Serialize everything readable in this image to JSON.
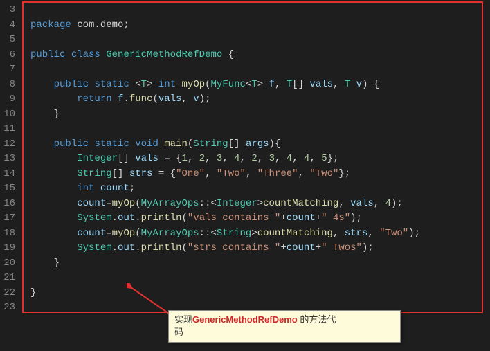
{
  "gutter": {
    "start": 3,
    "end": 23
  },
  "code_lines": [
    {
      "parts": [
        {
          "c": "pun",
          "t": ""
        }
      ]
    },
    {
      "parts": [
        {
          "c": "kw",
          "t": "package"
        },
        {
          "c": "pun",
          "t": " com.demo;"
        }
      ]
    },
    {
      "parts": [
        {
          "c": "pun",
          "t": ""
        }
      ]
    },
    {
      "parts": [
        {
          "c": "kw",
          "t": "public"
        },
        {
          "c": "pun",
          "t": " "
        },
        {
          "c": "kw",
          "t": "class"
        },
        {
          "c": "pun",
          "t": " "
        },
        {
          "c": "typ",
          "t": "GenericMethodRefDemo"
        },
        {
          "c": "pun",
          "t": " {"
        }
      ]
    },
    {
      "parts": [
        {
          "c": "pun",
          "t": ""
        }
      ]
    },
    {
      "parts": [
        {
          "c": "pun",
          "t": "    "
        },
        {
          "c": "kw",
          "t": "public"
        },
        {
          "c": "pun",
          "t": " "
        },
        {
          "c": "kw",
          "t": "static"
        },
        {
          "c": "pun",
          "t": " <"
        },
        {
          "c": "typ",
          "t": "T"
        },
        {
          "c": "pun",
          "t": "> "
        },
        {
          "c": "kw",
          "t": "int"
        },
        {
          "c": "pun",
          "t": " "
        },
        {
          "c": "mth",
          "t": "myOp"
        },
        {
          "c": "pun",
          "t": "("
        },
        {
          "c": "typ",
          "t": "MyFunc"
        },
        {
          "c": "pun",
          "t": "<"
        },
        {
          "c": "typ",
          "t": "T"
        },
        {
          "c": "pun",
          "t": "> "
        },
        {
          "c": "var",
          "t": "f"
        },
        {
          "c": "pun",
          "t": ", "
        },
        {
          "c": "typ",
          "t": "T"
        },
        {
          "c": "pun",
          "t": "[] "
        },
        {
          "c": "var",
          "t": "vals"
        },
        {
          "c": "pun",
          "t": ", "
        },
        {
          "c": "typ",
          "t": "T"
        },
        {
          "c": "pun",
          "t": " "
        },
        {
          "c": "var",
          "t": "v"
        },
        {
          "c": "pun",
          "t": ") {"
        }
      ]
    },
    {
      "parts": [
        {
          "c": "pun",
          "t": "        "
        },
        {
          "c": "kw",
          "t": "return"
        },
        {
          "c": "pun",
          "t": " "
        },
        {
          "c": "var",
          "t": "f"
        },
        {
          "c": "pun",
          "t": "."
        },
        {
          "c": "mth",
          "t": "func"
        },
        {
          "c": "pun",
          "t": "("
        },
        {
          "c": "var",
          "t": "vals"
        },
        {
          "c": "pun",
          "t": ", "
        },
        {
          "c": "var",
          "t": "v"
        },
        {
          "c": "pun",
          "t": ");"
        }
      ]
    },
    {
      "parts": [
        {
          "c": "pun",
          "t": "    }"
        }
      ]
    },
    {
      "parts": [
        {
          "c": "pun",
          "t": ""
        }
      ]
    },
    {
      "parts": [
        {
          "c": "pun",
          "t": "    "
        },
        {
          "c": "kw",
          "t": "public"
        },
        {
          "c": "pun",
          "t": " "
        },
        {
          "c": "kw",
          "t": "static"
        },
        {
          "c": "pun",
          "t": " "
        },
        {
          "c": "kw",
          "t": "void"
        },
        {
          "c": "pun",
          "t": " "
        },
        {
          "c": "mth",
          "t": "main"
        },
        {
          "c": "pun",
          "t": "("
        },
        {
          "c": "typ",
          "t": "String"
        },
        {
          "c": "pun",
          "t": "[] "
        },
        {
          "c": "var",
          "t": "args"
        },
        {
          "c": "pun",
          "t": "){"
        }
      ]
    },
    {
      "parts": [
        {
          "c": "pun",
          "t": "        "
        },
        {
          "c": "typ",
          "t": "Integer"
        },
        {
          "c": "pun",
          "t": "[] "
        },
        {
          "c": "var",
          "t": "vals"
        },
        {
          "c": "pun",
          "t": " = {"
        },
        {
          "c": "num",
          "t": "1"
        },
        {
          "c": "pun",
          "t": ", "
        },
        {
          "c": "num",
          "t": "2"
        },
        {
          "c": "pun",
          "t": ", "
        },
        {
          "c": "num",
          "t": "3"
        },
        {
          "c": "pun",
          "t": ", "
        },
        {
          "c": "num",
          "t": "4"
        },
        {
          "c": "pun",
          "t": ", "
        },
        {
          "c": "num",
          "t": "2"
        },
        {
          "c": "pun",
          "t": ", "
        },
        {
          "c": "num",
          "t": "3"
        },
        {
          "c": "pun",
          "t": ", "
        },
        {
          "c": "num",
          "t": "4"
        },
        {
          "c": "pun",
          "t": ", "
        },
        {
          "c": "num",
          "t": "4"
        },
        {
          "c": "pun",
          "t": ", "
        },
        {
          "c": "num",
          "t": "5"
        },
        {
          "c": "pun",
          "t": "};"
        }
      ]
    },
    {
      "parts": [
        {
          "c": "pun",
          "t": "        "
        },
        {
          "c": "typ",
          "t": "String"
        },
        {
          "c": "pun",
          "t": "[] "
        },
        {
          "c": "var",
          "t": "strs"
        },
        {
          "c": "pun",
          "t": " = {"
        },
        {
          "c": "str",
          "t": "\"One\""
        },
        {
          "c": "pun",
          "t": ", "
        },
        {
          "c": "str",
          "t": "\"Two\""
        },
        {
          "c": "pun",
          "t": ", "
        },
        {
          "c": "str",
          "t": "\"Three\""
        },
        {
          "c": "pun",
          "t": ", "
        },
        {
          "c": "str",
          "t": "\"Two\""
        },
        {
          "c": "pun",
          "t": "};"
        }
      ]
    },
    {
      "parts": [
        {
          "c": "pun",
          "t": "        "
        },
        {
          "c": "kw",
          "t": "int"
        },
        {
          "c": "pun",
          "t": " "
        },
        {
          "c": "var",
          "t": "count"
        },
        {
          "c": "pun",
          "t": ";"
        }
      ]
    },
    {
      "parts": [
        {
          "c": "pun",
          "t": "        "
        },
        {
          "c": "var",
          "t": "count"
        },
        {
          "c": "pun",
          "t": "="
        },
        {
          "c": "mth",
          "t": "myOp"
        },
        {
          "c": "pun",
          "t": "("
        },
        {
          "c": "typ",
          "t": "MyArrayOps"
        },
        {
          "c": "pun",
          "t": "::<"
        },
        {
          "c": "typ",
          "t": "Integer"
        },
        {
          "c": "pun",
          "t": ">"
        },
        {
          "c": "mth",
          "t": "countMatching"
        },
        {
          "c": "pun",
          "t": ", "
        },
        {
          "c": "var",
          "t": "vals"
        },
        {
          "c": "pun",
          "t": ", "
        },
        {
          "c": "num",
          "t": "4"
        },
        {
          "c": "pun",
          "t": ");"
        }
      ]
    },
    {
      "parts": [
        {
          "c": "pun",
          "t": "        "
        },
        {
          "c": "typ",
          "t": "System"
        },
        {
          "c": "pun",
          "t": "."
        },
        {
          "c": "var",
          "t": "out"
        },
        {
          "c": "pun",
          "t": "."
        },
        {
          "c": "mth",
          "t": "println"
        },
        {
          "c": "pun",
          "t": "("
        },
        {
          "c": "str",
          "t": "\"vals contains \""
        },
        {
          "c": "pun",
          "t": "+"
        },
        {
          "c": "var",
          "t": "count"
        },
        {
          "c": "pun",
          "t": "+"
        },
        {
          "c": "str",
          "t": "\" 4s\""
        },
        {
          "c": "pun",
          "t": ");"
        }
      ]
    },
    {
      "parts": [
        {
          "c": "pun",
          "t": "        "
        },
        {
          "c": "var",
          "t": "count"
        },
        {
          "c": "pun",
          "t": "="
        },
        {
          "c": "mth",
          "t": "myOp"
        },
        {
          "c": "pun",
          "t": "("
        },
        {
          "c": "typ",
          "t": "MyArrayOps"
        },
        {
          "c": "pun",
          "t": "::<"
        },
        {
          "c": "typ",
          "t": "String"
        },
        {
          "c": "pun",
          "t": ">"
        },
        {
          "c": "mth",
          "t": "countMatching"
        },
        {
          "c": "pun",
          "t": ", "
        },
        {
          "c": "var",
          "t": "strs"
        },
        {
          "c": "pun",
          "t": ", "
        },
        {
          "c": "str",
          "t": "\"Two\""
        },
        {
          "c": "pun",
          "t": ");"
        }
      ]
    },
    {
      "parts": [
        {
          "c": "pun",
          "t": "        "
        },
        {
          "c": "typ",
          "t": "System"
        },
        {
          "c": "pun",
          "t": "."
        },
        {
          "c": "var",
          "t": "out"
        },
        {
          "c": "pun",
          "t": "."
        },
        {
          "c": "mth",
          "t": "println"
        },
        {
          "c": "pun",
          "t": "("
        },
        {
          "c": "str",
          "t": "\"strs contains \""
        },
        {
          "c": "pun",
          "t": "+"
        },
        {
          "c": "var",
          "t": "count"
        },
        {
          "c": "pun",
          "t": "+"
        },
        {
          "c": "str",
          "t": "\" Twos\""
        },
        {
          "c": "pun",
          "t": ");"
        }
      ]
    },
    {
      "parts": [
        {
          "c": "pun",
          "t": "    }"
        }
      ]
    },
    {
      "parts": [
        {
          "c": "pun",
          "t": ""
        }
      ]
    },
    {
      "parts": [
        {
          "c": "pun",
          "t": "}"
        }
      ]
    },
    {
      "parts": [
        {
          "c": "pun",
          "t": ""
        }
      ]
    }
  ],
  "callout": {
    "prefix": "实现",
    "highlight": "GenericMethodRefDemo",
    "suffix1": " 的方法代",
    "suffix2": "码"
  },
  "colors": {
    "bg": "#1e1e1e",
    "gutter": "#858585",
    "redbox": "#e03030",
    "callout_bg": "#fefbda"
  }
}
